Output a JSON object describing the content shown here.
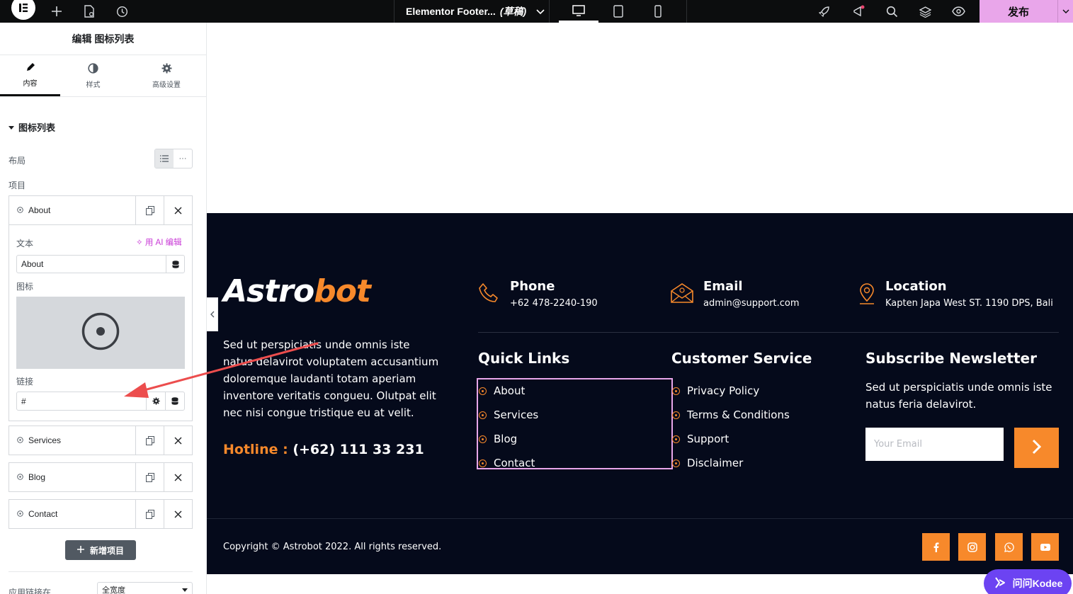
{
  "topbar": {
    "document_title": "Elementor Footer...",
    "status": "(草稿)",
    "publish_label": "发布"
  },
  "panel": {
    "title": "编辑 图标列表",
    "tabs": [
      {
        "label": "内容",
        "icon": "pencil-icon"
      },
      {
        "label": "样式",
        "icon": "half-circle-icon"
      },
      {
        "label": "高级设置",
        "icon": "gear-icon"
      }
    ],
    "section_title": "图标列表",
    "layout_label": "布局",
    "items_label": "项目",
    "items": [
      {
        "label": "About"
      },
      {
        "label": "Services"
      },
      {
        "label": "Blog"
      },
      {
        "label": "Contact"
      }
    ],
    "text_field_label": "文本",
    "ai_edit_label": "用 AI 编辑",
    "text_value": "About",
    "icon_field_label": "图标",
    "link_field_label": "链接",
    "link_value": "#",
    "add_item_label": "新增项目",
    "apply_link_label": "应用链接在",
    "width_select_value": "全宽度"
  },
  "footer": {
    "logo_part1": "Astro",
    "logo_part2": "bot",
    "about_text": "Sed ut perspiciatis unde omnis iste natus delavirot voluptatem accusantium doloremque laudanti totam aperiam inventore veritatis congueu. Olutpat elit nec nisi congue tristique eu at velit.",
    "hotline_label": "Hotline :",
    "hotline_value": "(+62) 111 33 231",
    "contacts": [
      {
        "title": "Phone",
        "value": "+62 478-2240-190",
        "icon": "phone-icon"
      },
      {
        "title": "Email",
        "value": "admin@support.com",
        "icon": "envelope-icon"
      },
      {
        "title": "Location",
        "value": "Kapten Japa West ST. 1190 DPS, Bali",
        "icon": "location-pin-icon"
      }
    ],
    "quick_links_title": "Quick Links",
    "quick_links": [
      "About",
      "Services",
      "Blog",
      "Contact"
    ],
    "customer_service_title": "Customer Service",
    "customer_service": [
      "Privacy Policy",
      "Terms & Conditions",
      "Support",
      "Disclaimer"
    ],
    "newsletter_title": "Subscribe Newsletter",
    "newsletter_text": "Sed ut perspiciatis unde omnis iste natus feria delavirot.",
    "email_placeholder": "Your Email",
    "copyright": "Copyright © Astrobot 2022. All rights reserved.",
    "socials": [
      "facebook-icon",
      "instagram-icon",
      "whatsapp-icon",
      "youtube-icon"
    ]
  },
  "assistant": {
    "label": "问问Kodee"
  },
  "colors": {
    "accent": "#f7892b",
    "footer_bg": "#050a1b",
    "publish": "#e9a6ea",
    "ai": "#c839d6",
    "kodee": "#6c43f2"
  }
}
